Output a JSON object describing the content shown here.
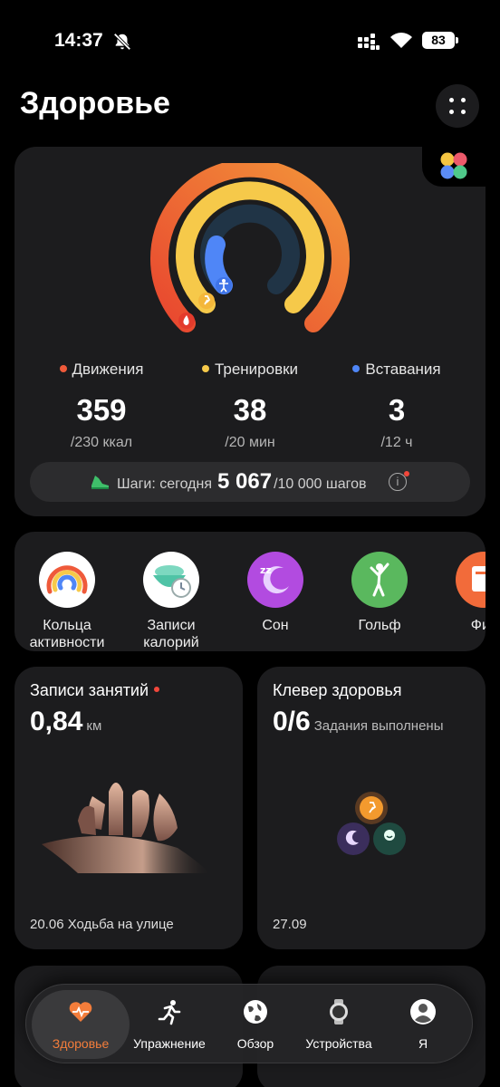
{
  "status_bar": {
    "time": "14:37",
    "battery": "83"
  },
  "header": {
    "title": "Здоровье"
  },
  "activity": {
    "stats": [
      {
        "label": "Движения",
        "value": "359",
        "goal": "/230 ккал",
        "color": "#ef5a3a"
      },
      {
        "label": "Тренировки",
        "value": "38",
        "goal": "/20 мин",
        "color": "#f6c94a"
      },
      {
        "label": "Вставания",
        "value": "3",
        "goal": "/12 ч",
        "color": "#4f86f7"
      }
    ],
    "steps": {
      "prefix": "Шаги: сегодня",
      "count": "5 067",
      "goal": "/10 000 шагов",
      "info_icon": "i"
    }
  },
  "apps": [
    {
      "line1": "Кольца",
      "line2": "активности",
      "icon": "activity-rings-icon"
    },
    {
      "line1": "Записи",
      "line2": "калорий",
      "icon": "calorie-bowl-icon"
    },
    {
      "line1": "Сон",
      "line2": "",
      "icon": "sleep-moon-icon"
    },
    {
      "line1": "Гольф",
      "line2": "",
      "icon": "golf-icon"
    },
    {
      "line1": "Фит",
      "line2": "",
      "icon": "fitness-icon"
    }
  ],
  "workouts": {
    "title": "Записи занятий",
    "value": "0,84",
    "unit": "км",
    "footer": "20.06 Ходьба на улице"
  },
  "clover": {
    "title": "Клевер здоровья",
    "value": "0/6",
    "subtitle": "Задания выполнены",
    "footer": "27.09"
  },
  "nav": [
    {
      "label": "Здоровье",
      "icon": "heart-pulse-icon",
      "active": true
    },
    {
      "label": "Упражнение",
      "icon": "running-icon",
      "active": false
    },
    {
      "label": "Обзор",
      "icon": "globe-icon",
      "active": false
    },
    {
      "label": "Устройства",
      "icon": "watch-icon",
      "active": false
    },
    {
      "label": "Я",
      "icon": "profile-icon",
      "active": false
    }
  ]
}
